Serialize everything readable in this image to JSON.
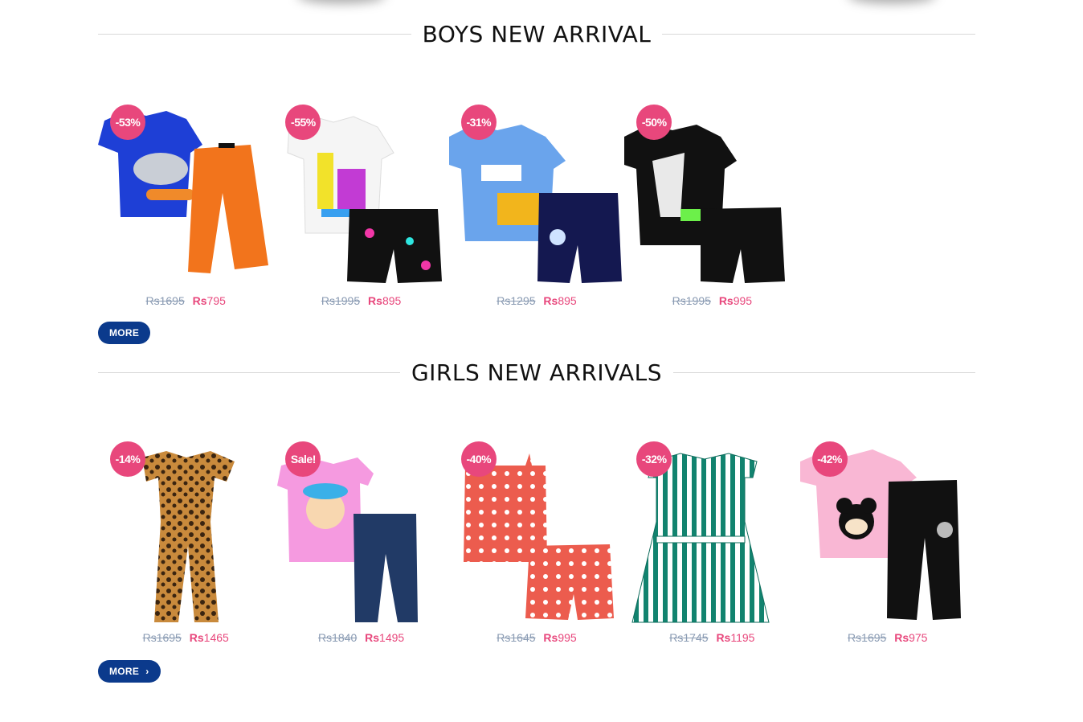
{
  "boys": {
    "title": "BOYS NEW ARRIVAL",
    "more_label": "MORE",
    "products": [
      {
        "badge": "-53%",
        "old_currency": "Rs",
        "old_price": "1695",
        "currency": "Rs",
        "price": "795",
        "art": "shark-tee-orange-pants"
      },
      {
        "badge": "-55%",
        "old_currency": "Rs",
        "old_price": "1995",
        "currency": "Rs",
        "price": "895",
        "art": "white-tee-splash-shorts"
      },
      {
        "badge": "-31%",
        "old_currency": "Rs",
        "old_price": "1295",
        "currency": "Rs",
        "price": "895",
        "art": "blue-tee-navy-shorts"
      },
      {
        "badge": "-50%",
        "old_currency": "Rs",
        "old_price": "1995",
        "currency": "Rs",
        "price": "995",
        "art": "black-tee-black-shorts"
      }
    ]
  },
  "girls": {
    "title": "GIRLS NEW ARRIVALS",
    "more_label": "MORE",
    "more_icon": "chevron-right-icon",
    "products": [
      {
        "badge": "-14%",
        "old_currency": "Rs",
        "old_price": "1695",
        "currency": "Rs",
        "price": "1465",
        "art": "leopard-jumpsuit"
      },
      {
        "badge": "Sale!",
        "old_currency": "Rs",
        "old_price": "1840",
        "currency": "Rs",
        "price": "1495",
        "art": "pink-tee-jeans"
      },
      {
        "badge": "-40%",
        "old_currency": "Rs",
        "old_price": "1645",
        "currency": "Rs",
        "price": "995",
        "art": "coral-cami-shorts"
      },
      {
        "badge": "-32%",
        "old_currency": "Rs",
        "old_price": "1745",
        "currency": "Rs",
        "price": "1195",
        "art": "green-stripe-dress"
      },
      {
        "badge": "-42%",
        "old_currency": "Rs",
        "old_price": "1695",
        "currency": "Rs",
        "price": "975",
        "art": "pink-tee-black-pants"
      }
    ]
  },
  "colors": {
    "badge": "#e8477c",
    "button": "#0b3a8c",
    "old_price": "#8a9bb3",
    "new_price": "#e8477c"
  }
}
